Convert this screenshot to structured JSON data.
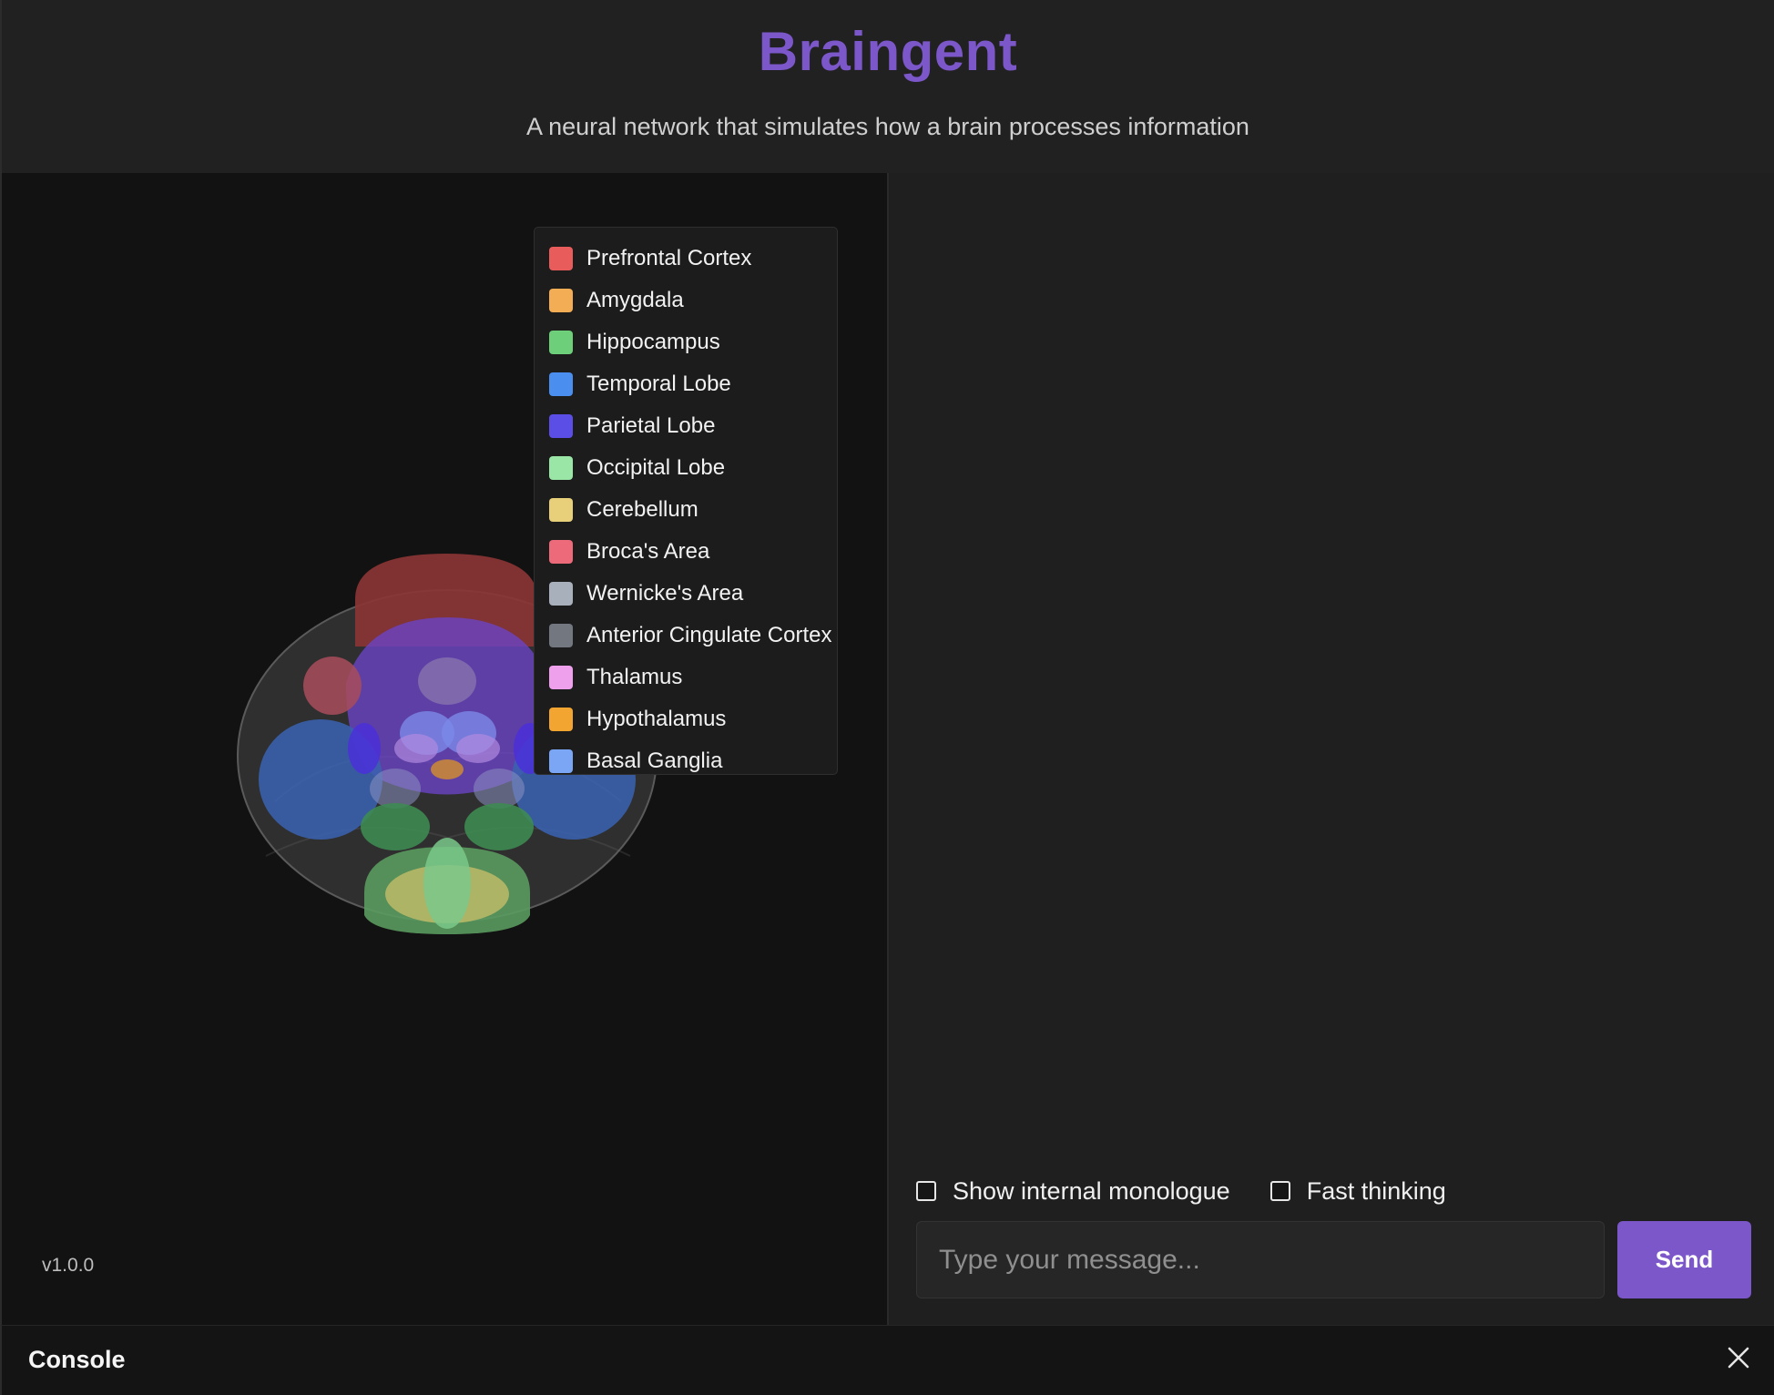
{
  "header": {
    "title": "Braingent",
    "subtitle": "A neural network that simulates how a brain processes information"
  },
  "legend": {
    "items": [
      {
        "label": "Prefrontal Cortex",
        "color": "#e85c5c"
      },
      {
        "label": "Amygdala",
        "color": "#f2ad55"
      },
      {
        "label": "Hippocampus",
        "color": "#6dcf7a"
      },
      {
        "label": "Temporal Lobe",
        "color": "#4a8ff0"
      },
      {
        "label": "Parietal Lobe",
        "color": "#5a4ee6"
      },
      {
        "label": "Occipital Lobe",
        "color": "#9ae6a6"
      },
      {
        "label": "Cerebellum",
        "color": "#e8cf7a"
      },
      {
        "label": "Broca's Area",
        "color": "#ec6a7a"
      },
      {
        "label": "Wernicke's Area",
        "color": "#a8b0bc"
      },
      {
        "label": "Anterior Cingulate Cortex",
        "color": "#737780"
      },
      {
        "label": "Thalamus",
        "color": "#eea0ec"
      },
      {
        "label": "Hypothalamus",
        "color": "#f2a531"
      },
      {
        "label": "Basal Ganglia",
        "color": "#7aa6f5"
      }
    ]
  },
  "version": "v1.0.0",
  "chat": {
    "show_monologue_label": "Show internal monologue",
    "show_monologue_checked": false,
    "fast_thinking_label": "Fast thinking",
    "fast_thinking_checked": false,
    "input_placeholder": "Type your message...",
    "input_value": "",
    "send_label": "Send"
  },
  "console": {
    "title": "Console",
    "close_icon": "close-icon"
  },
  "colors": {
    "accent": "#7b57c9"
  }
}
